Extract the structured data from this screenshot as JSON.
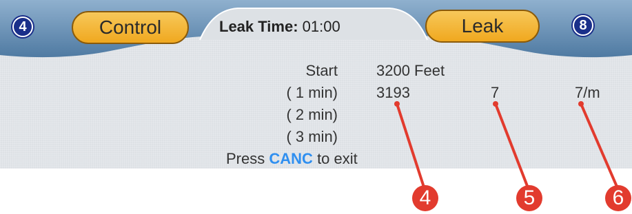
{
  "header": {
    "left_badge": "4",
    "right_badge": "8",
    "control_label": "Control",
    "leak_label": "Leak",
    "leak_time_label": "Leak Time:",
    "leak_time_value": "01:00"
  },
  "readings": {
    "start_label": "Start",
    "start_value": "3200 Feet",
    "rows": [
      {
        "label": "( 1 min)",
        "value": "3193",
        "diff": "7",
        "rate": "7/m"
      },
      {
        "label": "( 2 min)"
      },
      {
        "label": "( 3 min)"
      }
    ]
  },
  "footer": {
    "prefix": "Press",
    "key": "CANC",
    "suffix": "to exit"
  },
  "callouts": [
    "4",
    "5",
    "6"
  ],
  "colors": {
    "header_blue": "#6f95b8",
    "badge_blue": "#1a2f8a",
    "pill_orange": "#f3b43a",
    "highlight_blue": "#2f8ff0",
    "callout_red": "#e23b2e"
  }
}
